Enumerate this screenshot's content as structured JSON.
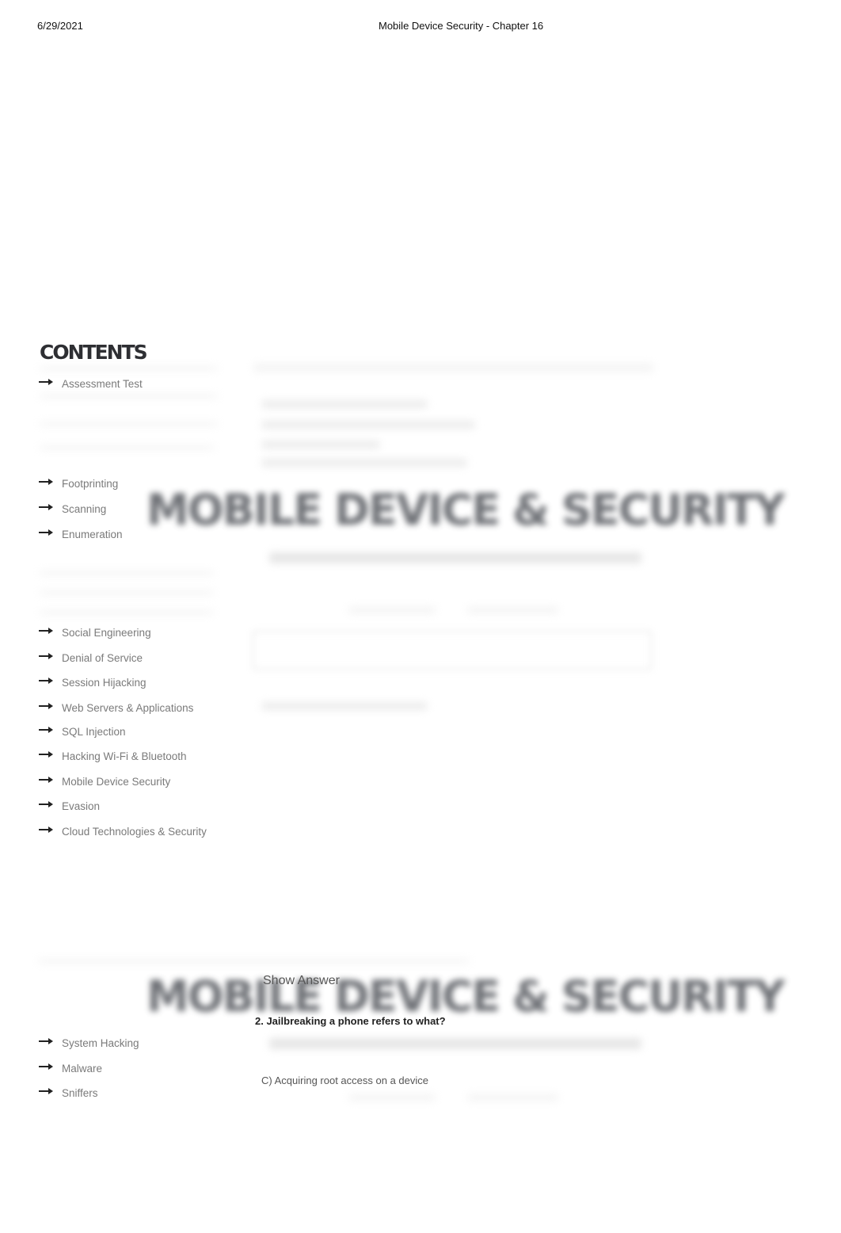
{
  "print_header": {
    "date": "6/29/2021",
    "title": "Mobile Device Security - Chapter 16"
  },
  "sidebar": {
    "title": "CONTENTS",
    "arrow_icon": "right-arrow-icon",
    "items": [
      {
        "label": "Assessment Test"
      },
      {
        "label": "Footprinting"
      },
      {
        "label": "Scanning"
      },
      {
        "label": "Enumeration"
      },
      {
        "label": "Social Engineering"
      },
      {
        "label": "Denial of Service"
      },
      {
        "label": "Session Hijacking"
      },
      {
        "label": "Web Servers & Applications"
      },
      {
        "label": "SQL Injection"
      },
      {
        "label": "Hacking Wi-Fi & Bluetooth"
      },
      {
        "label": "Mobile Device Security"
      },
      {
        "label": "Evasion"
      },
      {
        "label": "Cloud Technologies & Security"
      },
      {
        "label": "System Hacking"
      },
      {
        "label": "Malware"
      },
      {
        "label": "Sniffers"
      }
    ]
  },
  "main": {
    "banner_title": "MOBILE DEVICE & SECURITY",
    "show_answer_label": "Show Answer",
    "question": "2. Jailbreaking a phone refers to what?",
    "answer": "C) Acquiring root access on a device"
  }
}
